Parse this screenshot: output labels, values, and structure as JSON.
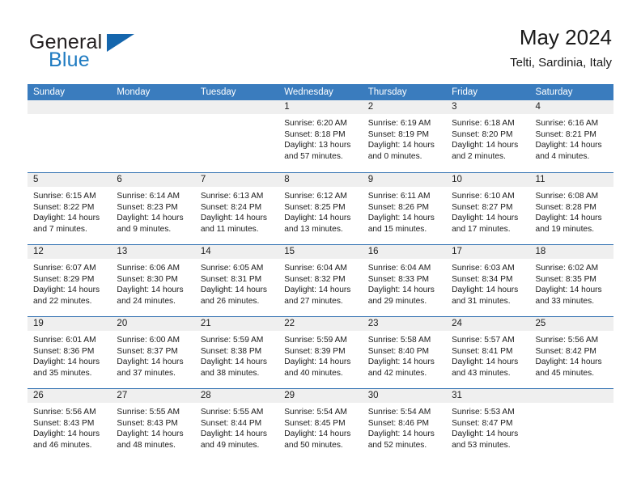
{
  "brand": {
    "name_part1": "General",
    "name_part2": "Blue",
    "triangle_color": "#1566ad",
    "blue_color": "#1f7bc1"
  },
  "header": {
    "title": "May 2024",
    "location": "Telti, Sardinia, Italy"
  },
  "theme": {
    "header_blue": "#3a7cbe",
    "divider_blue": "#2f6fb0",
    "daynum_band": "#efefef"
  },
  "weekdays": [
    "Sunday",
    "Monday",
    "Tuesday",
    "Wednesday",
    "Thursday",
    "Friday",
    "Saturday"
  ],
  "weeks": [
    [
      {
        "day": "",
        "empty": true
      },
      {
        "day": "",
        "empty": true
      },
      {
        "day": "",
        "empty": true
      },
      {
        "day": "1",
        "sunrise": "Sunrise: 6:20 AM",
        "sunset": "Sunset: 8:18 PM",
        "daylight1": "Daylight: 13 hours",
        "daylight2": "and 57 minutes."
      },
      {
        "day": "2",
        "sunrise": "Sunrise: 6:19 AM",
        "sunset": "Sunset: 8:19 PM",
        "daylight1": "Daylight: 14 hours",
        "daylight2": "and 0 minutes."
      },
      {
        "day": "3",
        "sunrise": "Sunrise: 6:18 AM",
        "sunset": "Sunset: 8:20 PM",
        "daylight1": "Daylight: 14 hours",
        "daylight2": "and 2 minutes."
      },
      {
        "day": "4",
        "sunrise": "Sunrise: 6:16 AM",
        "sunset": "Sunset: 8:21 PM",
        "daylight1": "Daylight: 14 hours",
        "daylight2": "and 4 minutes."
      }
    ],
    [
      {
        "day": "5",
        "sunrise": "Sunrise: 6:15 AM",
        "sunset": "Sunset: 8:22 PM",
        "daylight1": "Daylight: 14 hours",
        "daylight2": "and 7 minutes."
      },
      {
        "day": "6",
        "sunrise": "Sunrise: 6:14 AM",
        "sunset": "Sunset: 8:23 PM",
        "daylight1": "Daylight: 14 hours",
        "daylight2": "and 9 minutes."
      },
      {
        "day": "7",
        "sunrise": "Sunrise: 6:13 AM",
        "sunset": "Sunset: 8:24 PM",
        "daylight1": "Daylight: 14 hours",
        "daylight2": "and 11 minutes."
      },
      {
        "day": "8",
        "sunrise": "Sunrise: 6:12 AM",
        "sunset": "Sunset: 8:25 PM",
        "daylight1": "Daylight: 14 hours",
        "daylight2": "and 13 minutes."
      },
      {
        "day": "9",
        "sunrise": "Sunrise: 6:11 AM",
        "sunset": "Sunset: 8:26 PM",
        "daylight1": "Daylight: 14 hours",
        "daylight2": "and 15 minutes."
      },
      {
        "day": "10",
        "sunrise": "Sunrise: 6:10 AM",
        "sunset": "Sunset: 8:27 PM",
        "daylight1": "Daylight: 14 hours",
        "daylight2": "and 17 minutes."
      },
      {
        "day": "11",
        "sunrise": "Sunrise: 6:08 AM",
        "sunset": "Sunset: 8:28 PM",
        "daylight1": "Daylight: 14 hours",
        "daylight2": "and 19 minutes."
      }
    ],
    [
      {
        "day": "12",
        "sunrise": "Sunrise: 6:07 AM",
        "sunset": "Sunset: 8:29 PM",
        "daylight1": "Daylight: 14 hours",
        "daylight2": "and 22 minutes."
      },
      {
        "day": "13",
        "sunrise": "Sunrise: 6:06 AM",
        "sunset": "Sunset: 8:30 PM",
        "daylight1": "Daylight: 14 hours",
        "daylight2": "and 24 minutes."
      },
      {
        "day": "14",
        "sunrise": "Sunrise: 6:05 AM",
        "sunset": "Sunset: 8:31 PM",
        "daylight1": "Daylight: 14 hours",
        "daylight2": "and 26 minutes."
      },
      {
        "day": "15",
        "sunrise": "Sunrise: 6:04 AM",
        "sunset": "Sunset: 8:32 PM",
        "daylight1": "Daylight: 14 hours",
        "daylight2": "and 27 minutes."
      },
      {
        "day": "16",
        "sunrise": "Sunrise: 6:04 AM",
        "sunset": "Sunset: 8:33 PM",
        "daylight1": "Daylight: 14 hours",
        "daylight2": "and 29 minutes."
      },
      {
        "day": "17",
        "sunrise": "Sunrise: 6:03 AM",
        "sunset": "Sunset: 8:34 PM",
        "daylight1": "Daylight: 14 hours",
        "daylight2": "and 31 minutes."
      },
      {
        "day": "18",
        "sunrise": "Sunrise: 6:02 AM",
        "sunset": "Sunset: 8:35 PM",
        "daylight1": "Daylight: 14 hours",
        "daylight2": "and 33 minutes."
      }
    ],
    [
      {
        "day": "19",
        "sunrise": "Sunrise: 6:01 AM",
        "sunset": "Sunset: 8:36 PM",
        "daylight1": "Daylight: 14 hours",
        "daylight2": "and 35 minutes."
      },
      {
        "day": "20",
        "sunrise": "Sunrise: 6:00 AM",
        "sunset": "Sunset: 8:37 PM",
        "daylight1": "Daylight: 14 hours",
        "daylight2": "and 37 minutes."
      },
      {
        "day": "21",
        "sunrise": "Sunrise: 5:59 AM",
        "sunset": "Sunset: 8:38 PM",
        "daylight1": "Daylight: 14 hours",
        "daylight2": "and 38 minutes."
      },
      {
        "day": "22",
        "sunrise": "Sunrise: 5:59 AM",
        "sunset": "Sunset: 8:39 PM",
        "daylight1": "Daylight: 14 hours",
        "daylight2": "and 40 minutes."
      },
      {
        "day": "23",
        "sunrise": "Sunrise: 5:58 AM",
        "sunset": "Sunset: 8:40 PM",
        "daylight1": "Daylight: 14 hours",
        "daylight2": "and 42 minutes."
      },
      {
        "day": "24",
        "sunrise": "Sunrise: 5:57 AM",
        "sunset": "Sunset: 8:41 PM",
        "daylight1": "Daylight: 14 hours",
        "daylight2": "and 43 minutes."
      },
      {
        "day": "25",
        "sunrise": "Sunrise: 5:56 AM",
        "sunset": "Sunset: 8:42 PM",
        "daylight1": "Daylight: 14 hours",
        "daylight2": "and 45 minutes."
      }
    ],
    [
      {
        "day": "26",
        "sunrise": "Sunrise: 5:56 AM",
        "sunset": "Sunset: 8:43 PM",
        "daylight1": "Daylight: 14 hours",
        "daylight2": "and 46 minutes."
      },
      {
        "day": "27",
        "sunrise": "Sunrise: 5:55 AM",
        "sunset": "Sunset: 8:43 PM",
        "daylight1": "Daylight: 14 hours",
        "daylight2": "and 48 minutes."
      },
      {
        "day": "28",
        "sunrise": "Sunrise: 5:55 AM",
        "sunset": "Sunset: 8:44 PM",
        "daylight1": "Daylight: 14 hours",
        "daylight2": "and 49 minutes."
      },
      {
        "day": "29",
        "sunrise": "Sunrise: 5:54 AM",
        "sunset": "Sunset: 8:45 PM",
        "daylight1": "Daylight: 14 hours",
        "daylight2": "and 50 minutes."
      },
      {
        "day": "30",
        "sunrise": "Sunrise: 5:54 AM",
        "sunset": "Sunset: 8:46 PM",
        "daylight1": "Daylight: 14 hours",
        "daylight2": "and 52 minutes."
      },
      {
        "day": "31",
        "sunrise": "Sunrise: 5:53 AM",
        "sunset": "Sunset: 8:47 PM",
        "daylight1": "Daylight: 14 hours",
        "daylight2": "and 53 minutes."
      },
      {
        "day": "",
        "empty": true
      }
    ]
  ]
}
